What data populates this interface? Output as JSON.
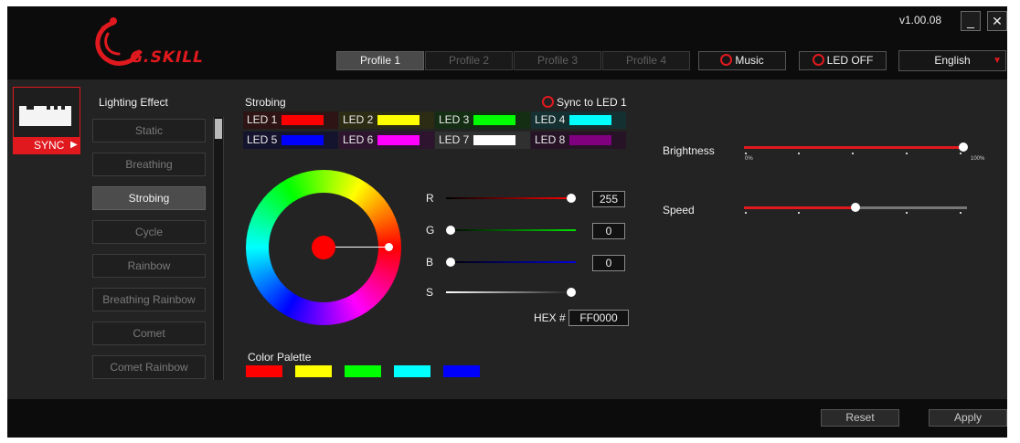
{
  "header": {
    "logo_text": "G.SKILL",
    "version": "v1.00.08",
    "minimize_label": "_",
    "close_label": "✕",
    "profiles": [
      "Profile 1",
      "Profile 2",
      "Profile 3",
      "Profile 4"
    ],
    "active_profile": "Profile 1",
    "music_label": "Music",
    "led_off_label": "LED OFF",
    "language": "English",
    "language_arrow": "▼"
  },
  "module": {
    "sync_label": "SYNC",
    "sync_arrow": "▶"
  },
  "lighting": {
    "title": "Lighting Effect",
    "effects": [
      "Static",
      "Breathing",
      "Strobing",
      "Cycle",
      "Rainbow",
      "Breathing Rainbow",
      "Comet",
      "Comet Rainbow"
    ],
    "active": "Strobing"
  },
  "strobing": {
    "title": "Strobing",
    "sync_led_label": "Sync to LED 1",
    "leds": [
      {
        "label": "LED 1",
        "color": "#ff0000",
        "bg": "#2e1414"
      },
      {
        "label": "LED 2",
        "color": "#ffff00",
        "bg": "#2c2c14"
      },
      {
        "label": "LED 3",
        "color": "#00ff00",
        "bg": "#142e14"
      },
      {
        "label": "LED 4",
        "color": "#00ffff",
        "bg": "#143030"
      },
      {
        "label": "LED 5",
        "color": "#0000ff",
        "bg": "#14142e"
      },
      {
        "label": "LED 6",
        "color": "#ff00ff",
        "bg": "#2e142e"
      },
      {
        "label": "LED 7",
        "color": "#ffffff",
        "bg": "#303030"
      },
      {
        "label": "LED 8",
        "color": "#800080",
        "bg": "#261426"
      }
    ]
  },
  "color_picker": {
    "current_color": "#ff0000",
    "r_label": "R",
    "g_label": "G",
    "b_label": "B",
    "s_label": "S",
    "r_value": "255",
    "g_value": "0",
    "b_value": "0",
    "s_level": 1.0,
    "hex_label": "HEX #",
    "hex_value": "FF0000"
  },
  "palette": {
    "title": "Color Palette",
    "colors": [
      "#ff0000",
      "#ffff00",
      "#00ff00",
      "#00ffff",
      "#0000ff"
    ]
  },
  "adjust": {
    "brightness_label": "Brightness",
    "brightness_level": 1.0,
    "brightness_min_label": "0%",
    "brightness_max_label": "100%",
    "speed_label": "Speed",
    "speed_level": 0.5
  },
  "footer": {
    "reset_label": "Reset",
    "apply_label": "Apply"
  },
  "colors": {
    "accent": "#e0191e"
  }
}
